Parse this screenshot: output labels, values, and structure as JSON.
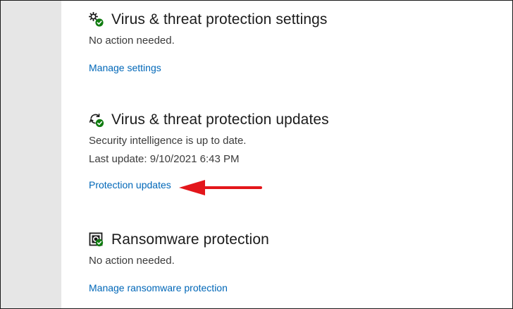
{
  "sections": [
    {
      "title": "Virus & threat protection settings",
      "icon": "gear-shield-icon",
      "status": "No action needed.",
      "link": "Manage settings"
    },
    {
      "title": "Virus & threat protection updates",
      "icon": "refresh-shield-icon",
      "status": "Security intelligence is up to date.",
      "last_update": "Last update: 9/10/2021 6:43 PM",
      "link": "Protection updates"
    },
    {
      "title": "Ransomware protection",
      "icon": "ransomware-shield-icon",
      "status": "No action needed.",
      "link": "Manage ransomware protection"
    }
  ],
  "annotation": {
    "arrow_color": "#e3161b",
    "icon": "red-arrow-icon"
  },
  "colors": {
    "link": "#0067b8",
    "check": "#107c10",
    "sidebar": "#e6e6e6"
  }
}
